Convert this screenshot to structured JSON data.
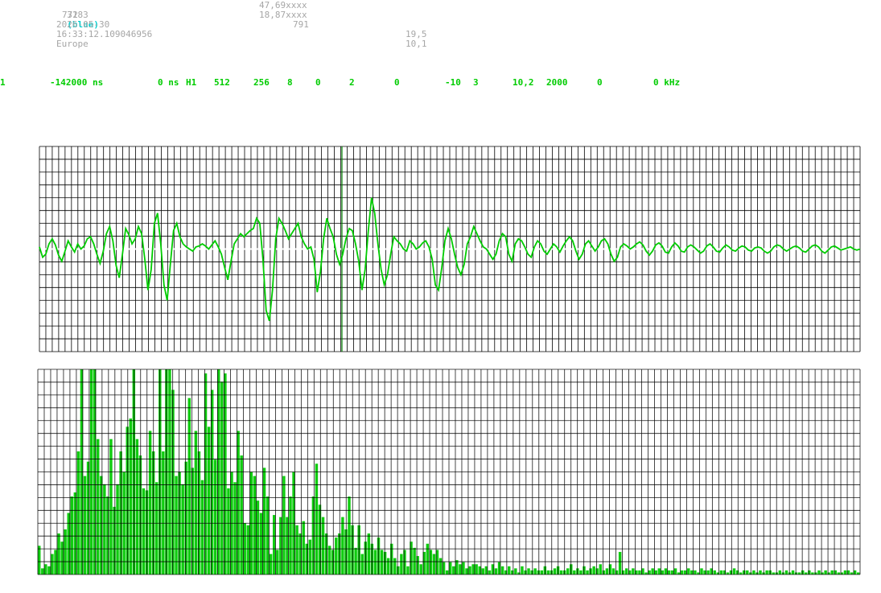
{
  "header": {
    "left": {
      "id_number": "3183",
      "id_color": "(blue)",
      "line2": "772",
      "date": "2026-05-30",
      "time": "16:33:12.109046956",
      "region": "Europe"
    },
    "mid": {
      "lat": "47,69xxxx",
      "lon": "18,87xxxx",
      "value": "791"
    },
    "right": {
      "v1": "19,5",
      "v2": "10,1"
    }
  },
  "params": [
    "1",
    "-142000 ns",
    "0 ns",
    "H1",
    "512",
    "256",
    "8",
    "0",
    "2",
    "0",
    "-10",
    "3",
    "10,2",
    "2000",
    "0",
    "0 kHz"
  ],
  "colors": {
    "signal": "#00cc00",
    "spectrum_fill": "#10cc10",
    "grid": "#000000",
    "marker": "#008000",
    "info_text": "#a6a6a6",
    "id_color": "#00d0d0"
  },
  "chart_data": [
    {
      "type": "line",
      "name": "waveform",
      "x_range": [
        0,
        255
      ],
      "y_range": [
        -1,
        1
      ],
      "grid": true,
      "marker_x": 94,
      "values": [
        0.02,
        -0.08,
        -0.05,
        0.05,
        0.1,
        0.04,
        -0.06,
        -0.12,
        -0.02,
        0.08,
        0.02,
        -0.03,
        0.05,
        0.0,
        0.03,
        0.1,
        0.12,
        0.05,
        -0.05,
        -0.14,
        -0.02,
        0.15,
        0.22,
        0.08,
        -0.16,
        -0.28,
        -0.05,
        0.2,
        0.14,
        0.05,
        0.1,
        0.22,
        0.15,
        -0.1,
        -0.4,
        -0.2,
        0.25,
        0.35,
        0.05,
        -0.35,
        -0.5,
        -0.15,
        0.18,
        0.25,
        0.12,
        0.05,
        0.02,
        0.0,
        -0.02,
        0.02,
        0.03,
        0.05,
        0.03,
        0.0,
        0.04,
        0.08,
        0.02,
        -0.05,
        -0.18,
        -0.3,
        -0.12,
        0.05,
        0.1,
        0.15,
        0.12,
        0.15,
        0.18,
        0.2,
        0.3,
        0.25,
        -0.1,
        -0.6,
        -0.7,
        -0.4,
        0.1,
        0.3,
        0.25,
        0.18,
        0.1,
        0.15,
        0.2,
        0.25,
        0.12,
        0.05,
        0.0,
        0.02,
        -0.1,
        -0.42,
        -0.22,
        0.1,
        0.3,
        0.2,
        0.12,
        -0.05,
        -0.15,
        -0.05,
        0.1,
        0.2,
        0.18,
        0.05,
        -0.12,
        -0.4,
        -0.2,
        0.18,
        0.5,
        0.35,
        0.05,
        -0.2,
        -0.35,
        -0.25,
        -0.05,
        0.12,
        0.08,
        0.05,
        0.0,
        -0.02,
        0.08,
        0.05,
        0.0,
        0.02,
        0.06,
        0.08,
        0.02,
        -0.1,
        -0.35,
        -0.4,
        -0.18,
        0.08,
        0.2,
        0.1,
        -0.05,
        -0.18,
        -0.25,
        -0.15,
        0.05,
        0.12,
        0.22,
        0.15,
        0.08,
        0.02,
        0.0,
        -0.05,
        -0.1,
        -0.05,
        0.08,
        0.15,
        0.12,
        -0.05,
        -0.12,
        0.05,
        0.1,
        0.08,
        0.02,
        -0.05,
        -0.08,
        0.02,
        0.08,
        0.05,
        -0.02,
        -0.05,
        0.0,
        0.05,
        0.02,
        -0.03,
        0.03,
        0.08,
        0.12,
        0.08,
        -0.02,
        -0.1,
        -0.05,
        0.05,
        0.08,
        0.03,
        -0.02,
        0.02,
        0.08,
        0.1,
        0.05,
        -0.05,
        -0.12,
        -0.08,
        0.02,
        0.05,
        0.03,
        0.0,
        0.02,
        0.05,
        0.07,
        0.04,
        -0.02,
        -0.06,
        -0.02,
        0.04,
        0.06,
        0.03,
        -0.03,
        -0.04,
        0.02,
        0.06,
        0.03,
        -0.02,
        -0.03,
        0.02,
        0.04,
        0.02,
        -0.01,
        -0.04,
        -0.02,
        0.03,
        0.05,
        0.02,
        -0.02,
        -0.03,
        0.01,
        0.04,
        0.02,
        -0.01,
        -0.02,
        0.01,
        0.03,
        0.02,
        -0.01,
        -0.02,
        0.01,
        0.02,
        0.01,
        -0.02,
        -0.04,
        -0.02,
        0.02,
        0.04,
        0.03,
        0.0,
        -0.02,
        0.0,
        0.02,
        0.03,
        0.01,
        -0.02,
        -0.03,
        0.0,
        0.03,
        0.04,
        0.02,
        -0.02,
        -0.04,
        -0.01,
        0.02,
        0.03,
        0.01,
        -0.01,
        0.0,
        0.01,
        0.02,
        0.0,
        -0.01,
        0.0
      ]
    },
    {
      "type": "bar",
      "name": "spectrum",
      "y_range": [
        0,
        1
      ],
      "grid": true,
      "values": [
        0.14,
        0.03,
        0.05,
        0.04,
        0.1,
        0.12,
        0.2,
        0.16,
        0.22,
        0.3,
        0.38,
        0.4,
        0.6,
        1.0,
        0.48,
        0.55,
        1.0,
        1.0,
        0.66,
        0.48,
        0.44,
        0.38,
        0.66,
        0.33,
        0.44,
        0.6,
        0.5,
        0.72,
        0.76,
        1.0,
        0.66,
        0.58,
        0.42,
        0.41,
        0.7,
        0.6,
        0.45,
        1.0,
        0.6,
        1.0,
        1.0,
        0.9,
        0.48,
        0.5,
        0.44,
        0.55,
        0.86,
        0.52,
        0.7,
        0.6,
        0.46,
        0.98,
        0.72,
        0.9,
        0.56,
        1.0,
        0.94,
        0.98,
        0.42,
        0.5,
        0.45,
        0.7,
        0.58,
        0.25,
        0.24,
        0.5,
        0.48,
        0.36,
        0.3,
        0.52,
        0.38,
        0.1,
        0.29,
        0.12,
        0.28,
        0.48,
        0.28,
        0.38,
        0.5,
        0.24,
        0.2,
        0.26,
        0.15,
        0.17,
        0.38,
        0.54,
        0.34,
        0.28,
        0.2,
        0.14,
        0.12,
        0.18,
        0.2,
        0.28,
        0.22,
        0.38,
        0.24,
        0.13,
        0.24,
        0.1,
        0.16,
        0.2,
        0.15,
        0.12,
        0.18,
        0.12,
        0.11,
        0.08,
        0.15,
        0.08,
        0.04,
        0.1,
        0.12,
        0.04,
        0.16,
        0.13,
        0.09,
        0.05,
        0.11,
        0.15,
        0.12,
        0.1,
        0.12,
        0.08,
        0.06,
        0.02,
        0.06,
        0.04,
        0.07,
        0.05,
        0.06,
        0.03,
        0.04,
        0.05,
        0.05,
        0.04,
        0.03,
        0.04,
        0.02,
        0.05,
        0.03,
        0.06,
        0.04,
        0.02,
        0.04,
        0.02,
        0.03,
        0.01,
        0.04,
        0.02,
        0.03,
        0.02,
        0.03,
        0.02,
        0.02,
        0.04,
        0.02,
        0.02,
        0.03,
        0.04,
        0.02,
        0.02,
        0.03,
        0.05,
        0.02,
        0.03,
        0.02,
        0.04,
        0.02,
        0.03,
        0.04,
        0.03,
        0.05,
        0.02,
        0.03,
        0.05,
        0.03,
        0.02,
        0.11,
        0.02,
        0.03,
        0.02,
        0.03,
        0.02,
        0.02,
        0.03,
        0.01,
        0.02,
        0.03,
        0.02,
        0.03,
        0.02,
        0.03,
        0.02,
        0.02,
        0.03,
        0.01,
        0.02,
        0.02,
        0.03,
        0.02,
        0.02,
        0.01,
        0.03,
        0.02,
        0.02,
        0.03,
        0.02,
        0.01,
        0.02,
        0.02,
        0.01,
        0.02,
        0.03,
        0.02,
        0.01,
        0.02,
        0.02,
        0.01,
        0.02,
        0.01,
        0.02,
        0.01,
        0.02,
        0.02,
        0.01,
        0.01,
        0.02,
        0.01,
        0.02,
        0.01,
        0.02,
        0.01,
        0.01,
        0.02,
        0.01,
        0.02,
        0.01,
        0.01,
        0.02,
        0.01,
        0.02,
        0.01,
        0.02,
        0.02,
        0.01,
        0.01,
        0.02,
        0.02,
        0.01,
        0.02,
        0.01
      ]
    }
  ]
}
